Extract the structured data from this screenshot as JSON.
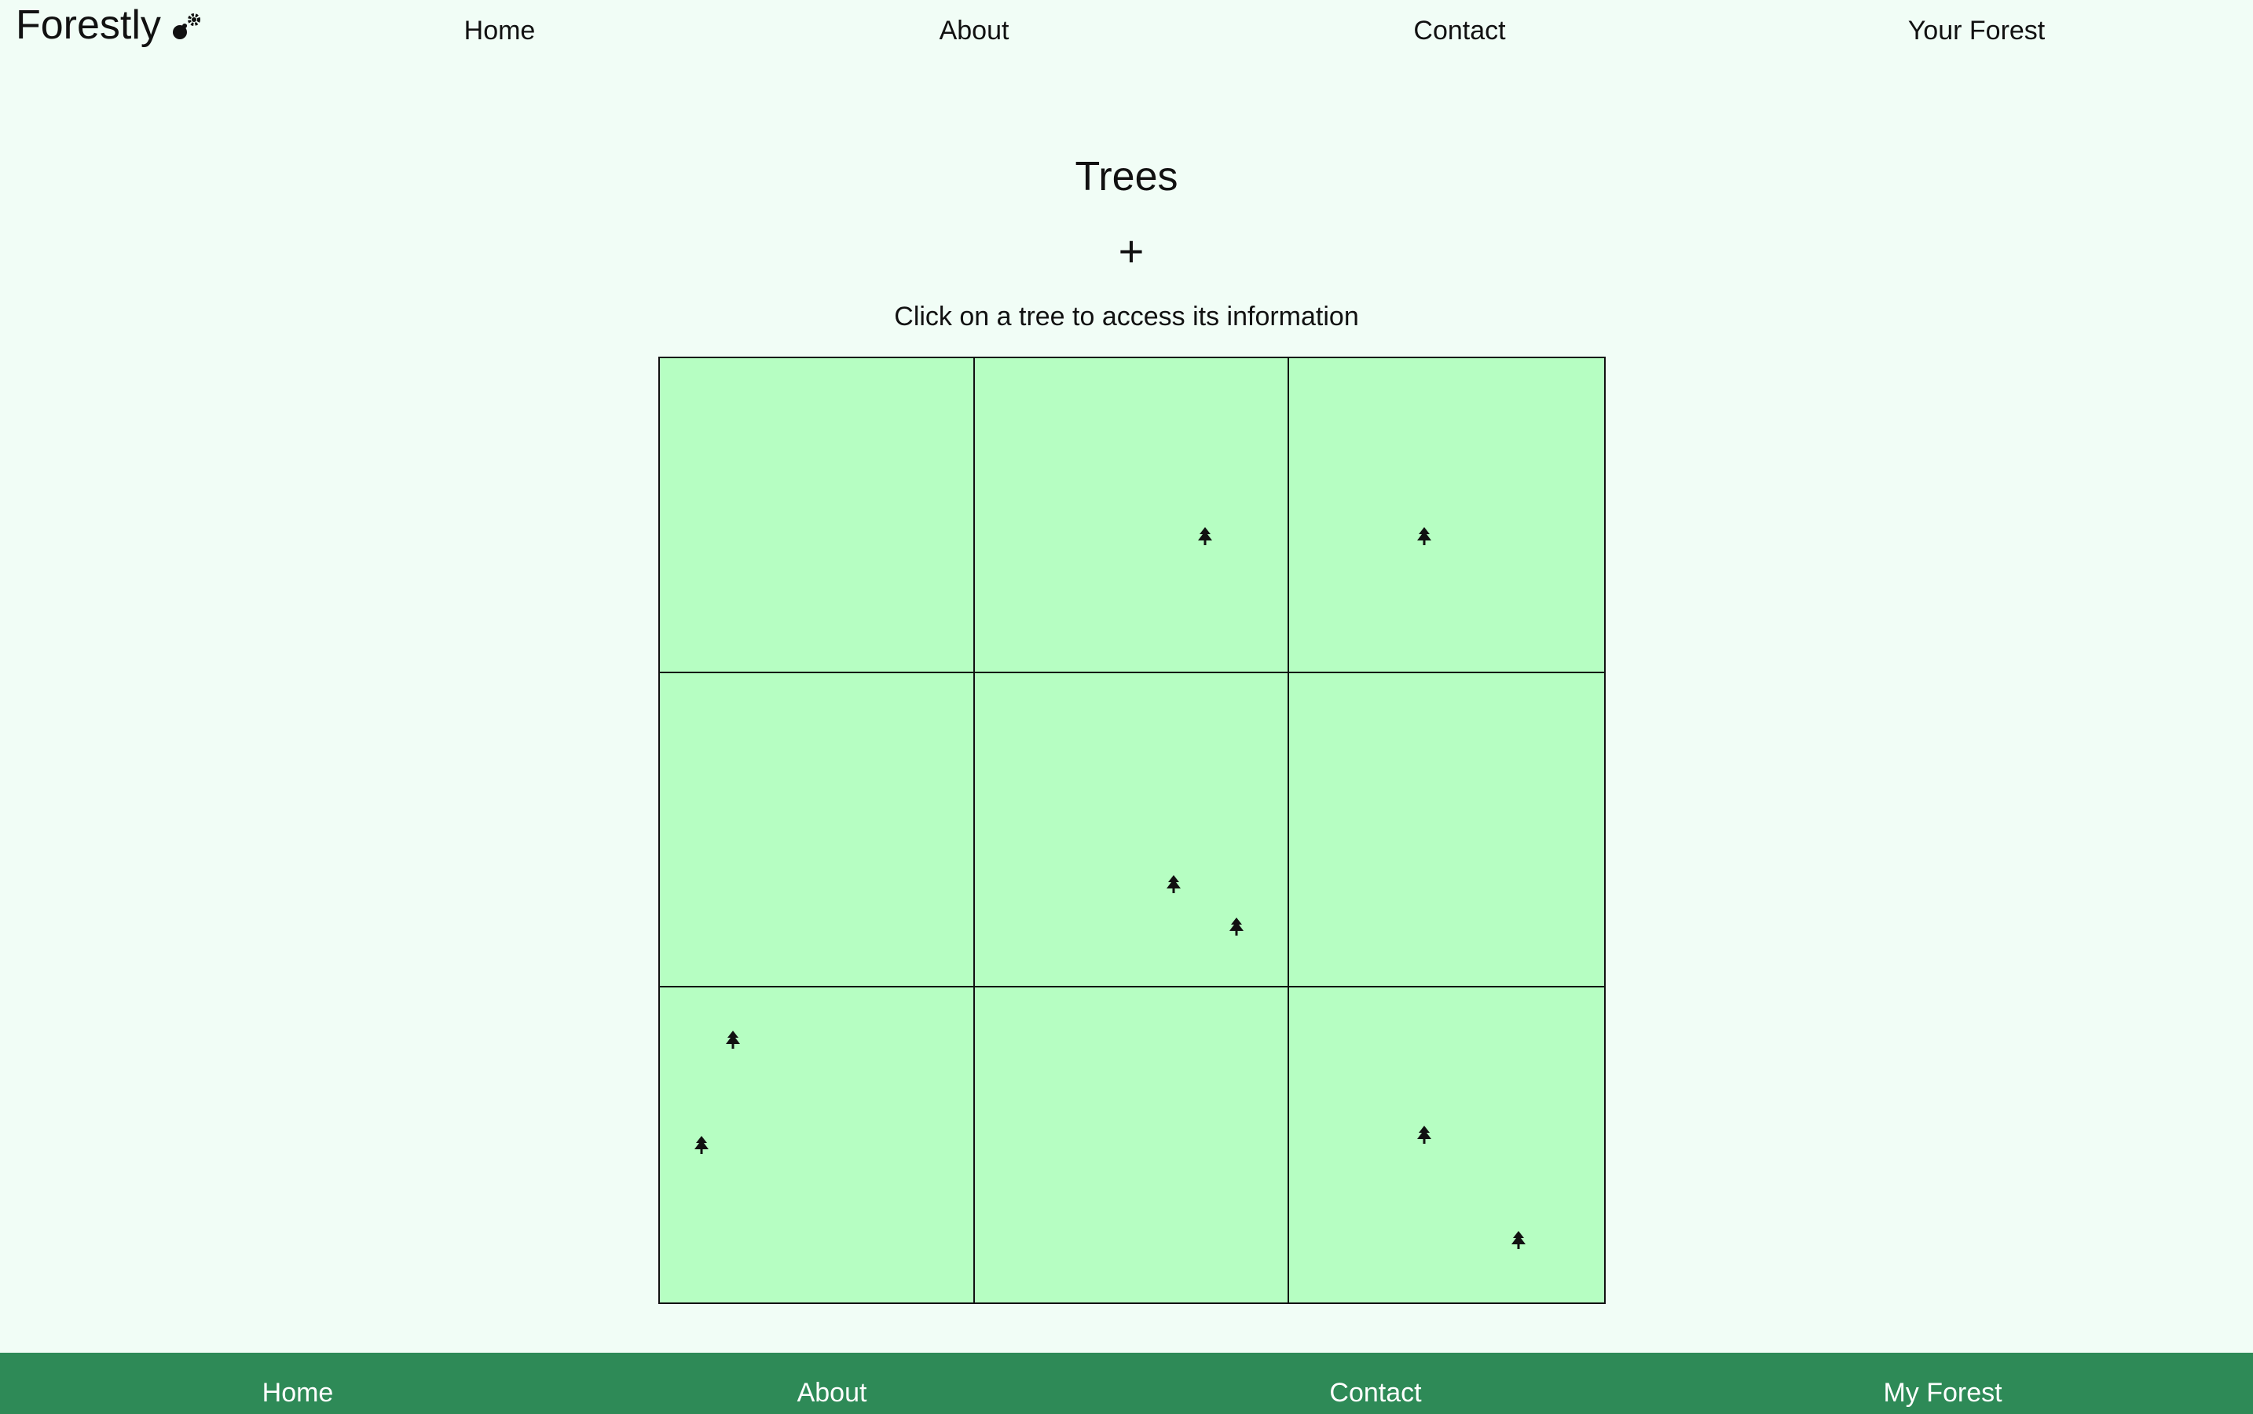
{
  "header": {
    "brand": "Forestly",
    "brand_icon": "seedling-icon",
    "nav": [
      {
        "label": "Home"
      },
      {
        "label": "About"
      },
      {
        "label": "Contact"
      },
      {
        "label": "Your Forest"
      }
    ]
  },
  "main": {
    "title": "Trees",
    "add_label": "+",
    "instructions": "Click on a tree to access its information",
    "grid": {
      "rows": 3,
      "cols": 3,
      "cell_color": "#b6fec2",
      "tree_icon": "tree-icon",
      "trees_per_cell": [
        0,
        1,
        1,
        0,
        2,
        0,
        2,
        0,
        2
      ]
    }
  },
  "footer": {
    "links": [
      {
        "label": "Home"
      },
      {
        "label": "About"
      },
      {
        "label": "Contact"
      },
      {
        "label": "My Forest"
      }
    ],
    "background": "#2e8a57"
  },
  "colors": {
    "page_bg": "#f1fdf6",
    "accent": "#2e8a57"
  }
}
